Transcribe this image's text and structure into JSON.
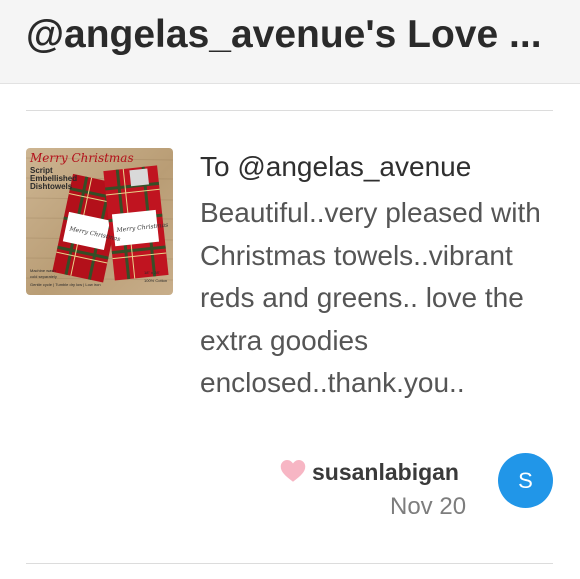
{
  "header": {
    "title": "@angelas_avenue's Love ..."
  },
  "review": {
    "addressee": "To @angelas_avenue",
    "message": "Beautiful..very pleased with Christmas towels..vibrant reds and greens.. love the extra goodies enclosed..thank.you..",
    "username": "susanlabigan",
    "date": "Nov 20",
    "avatar_letter": "S",
    "heart_icon": "heart-icon",
    "product_image": {
      "script_title": "Merry Christmas",
      "line1": "Script",
      "line2": "Embellished",
      "line3": "Dishtowels",
      "towel_text": "Merry Christmas",
      "care_line1": "Machine wash",
      "care_line2": "cold separately",
      "care_line3": "Gentle cycle | Tumble dry low | Low iron",
      "size_line1": "18\" x 28\"",
      "size_line2": "100% Cotton"
    }
  },
  "colors": {
    "accent_blue": "#2196e8",
    "heart_pink": "#f7b6c4",
    "header_bg": "#f5f5f5"
  }
}
